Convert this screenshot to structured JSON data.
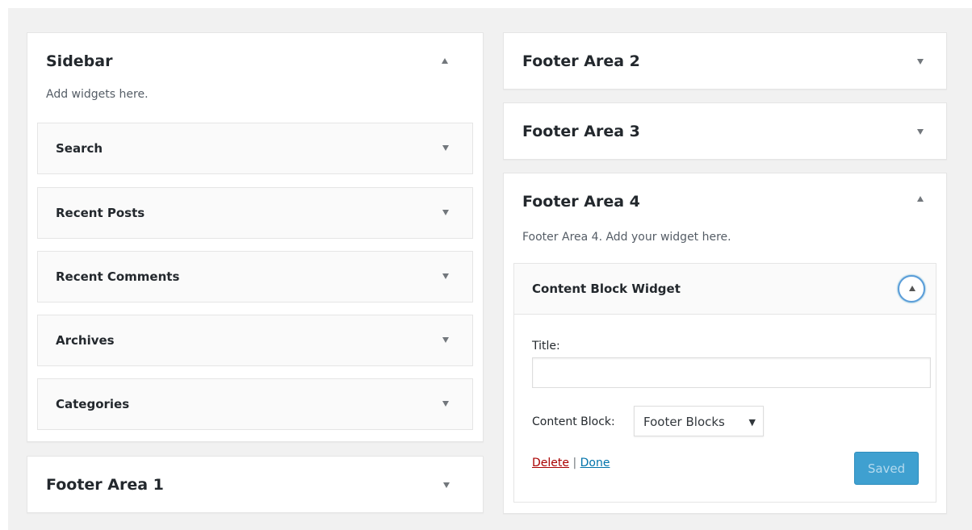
{
  "sidebar": {
    "title": "Sidebar",
    "description": "Add widgets here.",
    "widgets": [
      {
        "label": "Search"
      },
      {
        "label": "Recent Posts"
      },
      {
        "label": "Recent Comments"
      },
      {
        "label": "Archives"
      },
      {
        "label": "Categories"
      }
    ]
  },
  "footer_area_1": {
    "title": "Footer Area 1"
  },
  "footer_area_2": {
    "title": "Footer Area 2"
  },
  "footer_area_3": {
    "title": "Footer Area 3"
  },
  "footer_area_4": {
    "title": "Footer Area 4",
    "description": "Footer Area 4. Add your widget here.",
    "content_block_widget": {
      "label": "Content Block Widget",
      "title_label": "Title:",
      "title_value": "",
      "content_block_label": "Content Block:",
      "content_block_selected": "Footer Blocks",
      "delete_label": "Delete",
      "separator": "|",
      "done_label": "Done",
      "saved_label": "Saved"
    }
  },
  "colors": {
    "accent": "#0073aa",
    "delete": "#a00",
    "saved_button": "#1e90c8"
  },
  "icons": {
    "collapse": "triangle-up-icon",
    "expand": "triangle-down-icon"
  }
}
